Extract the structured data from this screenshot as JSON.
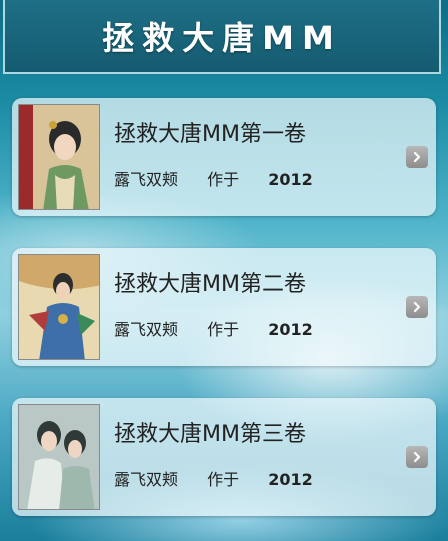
{
  "header": {
    "title": "拯救大唐MM"
  },
  "books": [
    {
      "title": "拯救大唐MM第一卷",
      "author": "露飞双颊",
      "label": "作于",
      "year": "2012"
    },
    {
      "title": "拯救大唐MM第二卷",
      "author": "露飞双颊",
      "label": "作于",
      "year": "2012"
    },
    {
      "title": "拯救大唐MM第三卷",
      "author": "露飞双颊",
      "label": "作于",
      "year": "2012"
    }
  ],
  "icons": {
    "next": "chevron-right-icon"
  }
}
